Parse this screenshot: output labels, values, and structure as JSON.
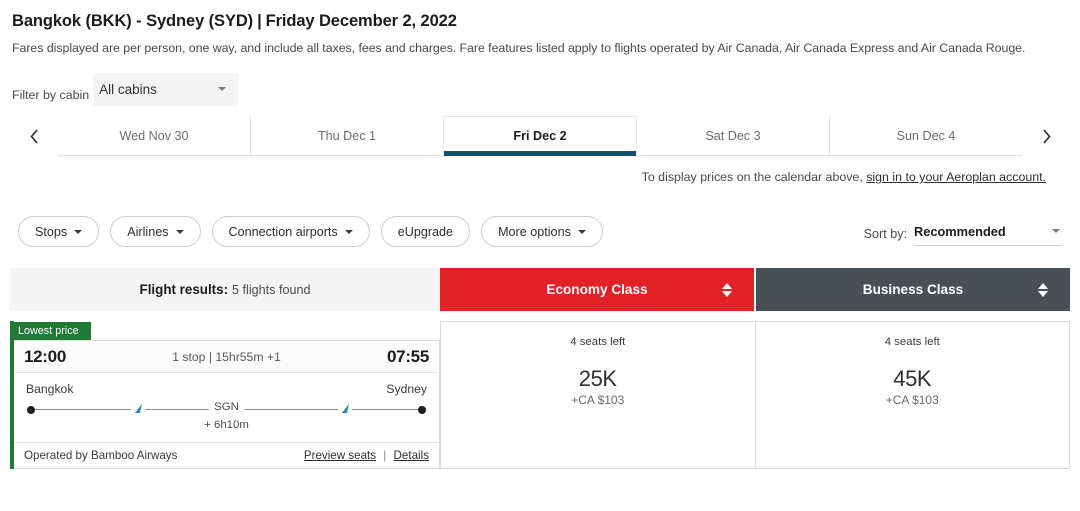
{
  "header": {
    "route": "Bangkok (BKK) - Sydney (SYD)",
    "separator": "|",
    "date": "Friday December 2, 2022",
    "subtitle": "Fares displayed are per person, one way, and include all taxes, fees and charges. Fare features listed apply to flights operated by Air Canada, Air Canada Express and Air Canada Rouge."
  },
  "cabin_filter": {
    "label": "Filter by cabin",
    "value": "All cabins",
    "caret_icon": "chevron-down-icon"
  },
  "date_strip": {
    "prev_icon": "chevron-left-icon",
    "next_icon": "chevron-right-icon",
    "tabs": [
      {
        "label": "Wed Nov 30",
        "active": false
      },
      {
        "label": "Thu Dec 1",
        "active": false
      },
      {
        "label": "Fri Dec 2",
        "active": true
      },
      {
        "label": "Sat Dec 3",
        "active": false
      },
      {
        "label": "Sun Dec 4",
        "active": false
      }
    ],
    "active_underline_color": "#11516e"
  },
  "signin_notice": {
    "text": "To display prices on the calendar above,",
    "link": "sign in to your Aeroplan account."
  },
  "filters": [
    {
      "label": "Stops",
      "has_caret": true
    },
    {
      "label": "Airlines",
      "has_caret": true
    },
    {
      "label": "Connection airports",
      "has_caret": true
    },
    {
      "label": "eUpgrade",
      "has_caret": false
    },
    {
      "label": "More options",
      "has_caret": true
    }
  ],
  "sort": {
    "label": "Sort by:",
    "value": "Recommended",
    "caret_icon": "chevron-down-icon"
  },
  "results_header": {
    "results_label": "Flight results:",
    "results_count": "5 flights found",
    "columns": [
      {
        "label": "Economy Class",
        "color": "#e32128"
      },
      {
        "label": "Business Class",
        "color": "#4a4f55"
      }
    ]
  },
  "flight": {
    "badge": "Lowest price",
    "depart_time": "12:00",
    "arrive_time": "07:55",
    "summary": "1 stop | 15hr55m +1",
    "origin_city": "Bangkok",
    "destination_city": "Sydney",
    "stop_code": "SGN",
    "layover": "+ 6h10m",
    "operated_by": "Operated by Bamboo Airways",
    "preview_seats": "Preview seats",
    "details": "Details",
    "footer_separator": "|",
    "fares": [
      {
        "seats": "4 seats left",
        "points": "25K",
        "cash": "+CA $103"
      },
      {
        "seats": "4 seats left",
        "points": "45K",
        "cash": "+CA $103"
      }
    ]
  }
}
